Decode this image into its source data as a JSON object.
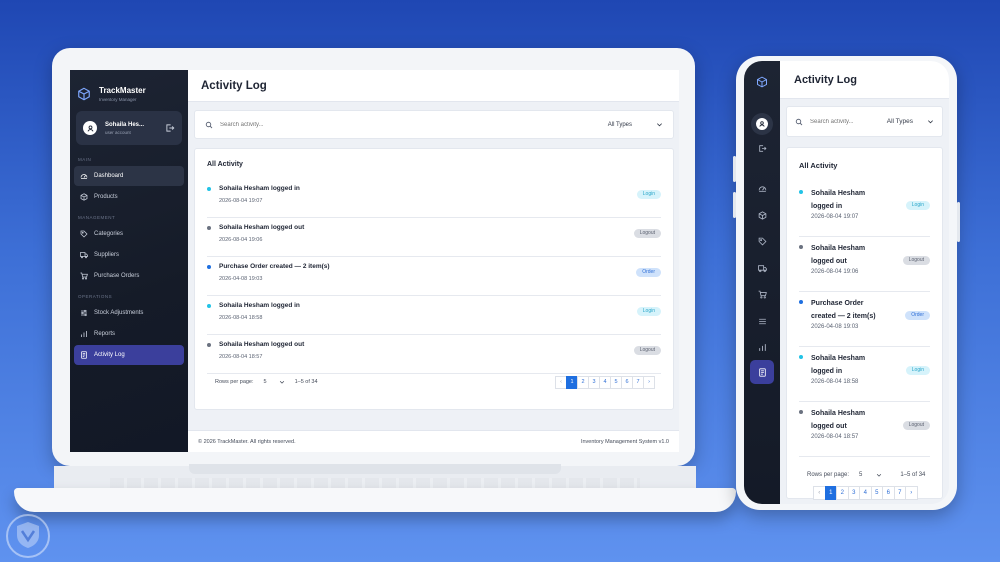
{
  "app": {
    "brand_name": "TrackMaster",
    "brand_sub": "Inventory Manager",
    "page_title": "Activity Log",
    "accent_color": "#3b3f9c"
  },
  "user": {
    "name": "Sohaila Hes...",
    "role": "user account"
  },
  "sidebar": {
    "sections": [
      "MAIN",
      "MANAGEMENT",
      "OPERATIONS"
    ],
    "items": [
      {
        "label": "Dashboard",
        "icon": "dashboard-icon"
      },
      {
        "label": "Products",
        "icon": "box-icon"
      },
      {
        "label": "Categories",
        "icon": "tag-icon"
      },
      {
        "label": "Suppliers",
        "icon": "truck-icon"
      },
      {
        "label": "Purchase Orders",
        "icon": "cart-icon"
      },
      {
        "label": "Stock Adjustments",
        "icon": "sliders-icon"
      },
      {
        "label": "Reports",
        "icon": "bar-chart-icon"
      },
      {
        "label": "Activity Log",
        "icon": "document-icon",
        "active": true
      }
    ]
  },
  "search": {
    "placeholder": "Search activity...",
    "filter_value": "All Types"
  },
  "list": {
    "title": "All Activity",
    "items": [
      {
        "text": "Sohaila Hesham logged in",
        "time": "2026-08-04 19:07",
        "badge": "Login",
        "dot": "#22c3e6"
      },
      {
        "text": "Sohaila Hesham logged out",
        "time": "2026-08-04 19:06",
        "badge": "Logout",
        "dot": "#6b7280"
      },
      {
        "text": "Purchase Order created — 2 item(s)",
        "time": "2026-04-08 19:03",
        "badge": "Order",
        "dot": "#1f6fe0"
      },
      {
        "text": "Sohaila Hesham logged in",
        "time": "2026-08-04 18:58",
        "badge": "Login",
        "dot": "#22c3e6"
      },
      {
        "text": "Sohaila Hesham logged out",
        "time": "2026-08-04 18:57",
        "badge": "Logout",
        "dot": "#6b7280"
      }
    ]
  },
  "mobile_list": {
    "items": [
      {
        "line1": "Sohaila Hesham",
        "line2": "logged in"
      },
      {
        "line1": "Sohaila Hesham",
        "line2": "logged out"
      },
      {
        "line1": "Purchase Order",
        "line2": "created — 2 item(s)"
      },
      {
        "line1": "Sohaila Hesham",
        "line2": "logged in"
      },
      {
        "line1": "Sohaila Hesham",
        "line2": "logged out"
      }
    ]
  },
  "pagination": {
    "rows_label": "Rows per page:",
    "rows_value": "5",
    "range": "1–5 of 34",
    "prev": "‹",
    "next": "›",
    "pages": [
      "1",
      "2",
      "3",
      "4",
      "5",
      "6",
      "7"
    ],
    "current": "1"
  },
  "footer": {
    "copyright": "© 2026 TrackMaster. All rights reserved.",
    "version": "Inventory Management System v1.0"
  }
}
